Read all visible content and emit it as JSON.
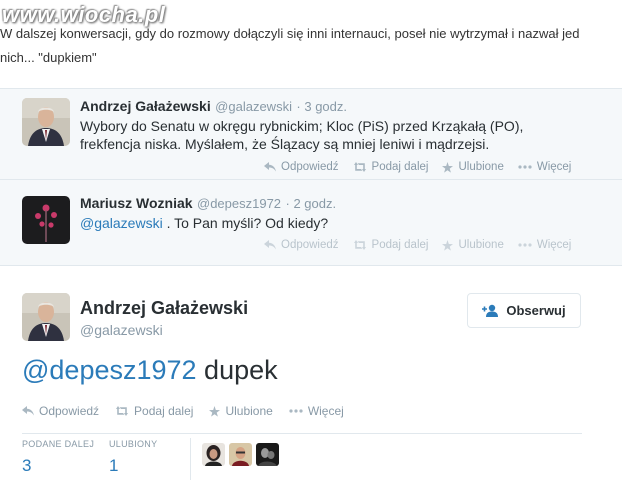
{
  "watermark": "www.wiocha.pl",
  "intro": {
    "line1": "W dalszej konwersacji, gdy do rozmowy dołączyli się inni internauci, poseł nie wytrzymał i nazwał jed",
    "line2": "nich... \"dupkiem\""
  },
  "tweets": [
    {
      "name": "Andrzej Gałażewski",
      "handle": "@galazewski",
      "time": "· 3 godz.",
      "text_line1": "Wybory do Senatu w okręgu rybnickim; Kloc (PiS) przed Krząkałą (PO),",
      "text_line2": "frekfencja niska. Myślałem, że Ślązacy są mniej leniwi i mądrzejsi."
    },
    {
      "name": "Mariusz Wozniak",
      "handle": "@depesz1972",
      "time": "· 2 godz.",
      "mention": "@galazewski",
      "text": " . To Pan myśli? Od kiedy?"
    }
  ],
  "actions": {
    "reply": "Odpowiedź",
    "retweet": "Podaj dalej",
    "favorite": "Ulubione",
    "more": "Więcej"
  },
  "main_tweet": {
    "name": "Andrzej Gałażewski",
    "handle": "@galazewski",
    "follow": "Obserwuj",
    "mention": "@depesz1972",
    "text": " dupek",
    "stats": {
      "retweets_label": "PODANE DALEJ",
      "retweets": "3",
      "favorites_label": "ULUBIONY",
      "favorites": "1"
    }
  },
  "colors": {
    "link": "#2b7bb9",
    "muted": "#8899a6",
    "thread_bg": "#f5f8fa"
  }
}
